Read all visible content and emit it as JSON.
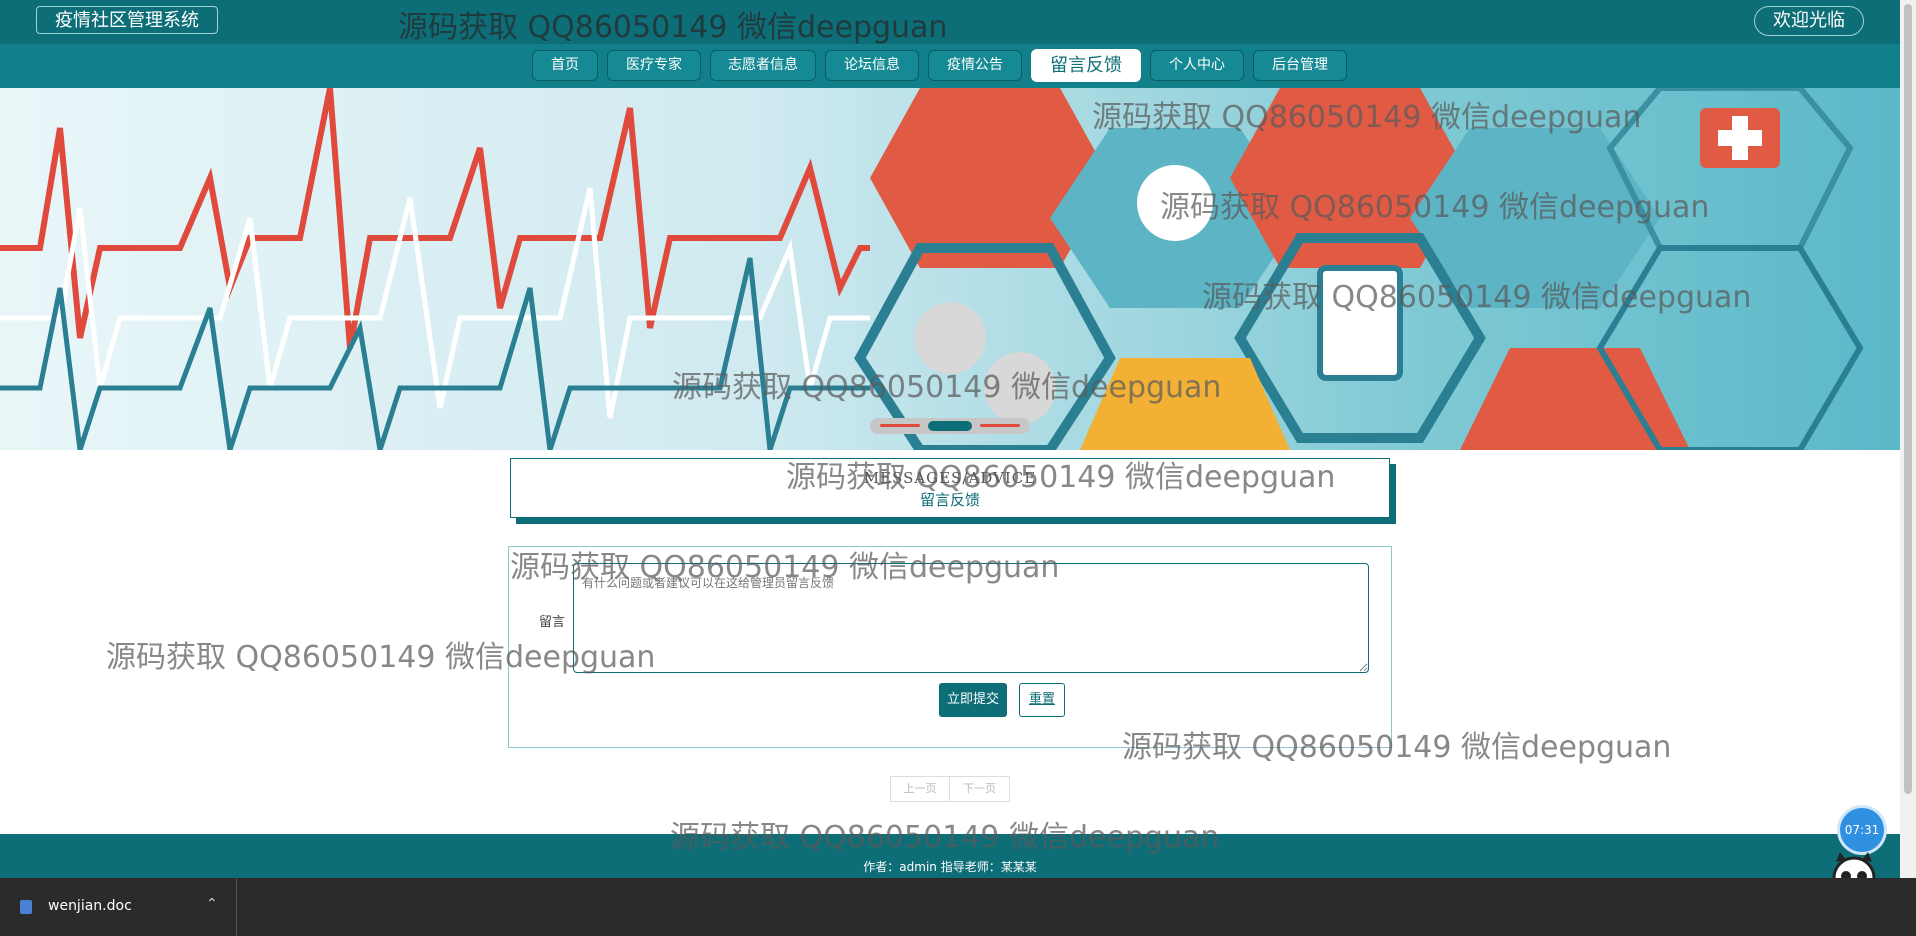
{
  "header": {
    "brand": "疫情社区管理系统",
    "welcome": "欢迎光临"
  },
  "nav": {
    "items": [
      {
        "label": "首页",
        "w": 66
      },
      {
        "label": "医疗专家",
        "w": 94
      },
      {
        "label": "志愿者信息",
        "w": 106
      },
      {
        "label": "论坛信息",
        "w": 94
      },
      {
        "label": "疫情公告",
        "w": 94
      },
      {
        "label": "留言反馈",
        "w": 110
      },
      {
        "label": "个人中心",
        "w": 94
      },
      {
        "label": "后台管理",
        "w": 94
      }
    ],
    "active_index": 5
  },
  "banner": {
    "slide_count": 3,
    "active_slide": 1
  },
  "section": {
    "title_en": "MESSAGES/ADVICE",
    "title_cn": "留言反馈"
  },
  "form": {
    "label": "留言",
    "placeholder": "有什么问题或者建议可以在这给管理员留言反馈",
    "submit_label": "立即提交",
    "reset_label": "重置"
  },
  "pagination": {
    "prev_label": "上一页",
    "next_label": "下一页"
  },
  "footer": {
    "text": "作者：admin 指导老师：某某某"
  },
  "clock": {
    "time": "07:31"
  },
  "taskbar": {
    "file_name": "wenjian.doc"
  },
  "watermark": {
    "text": "源码获取 QQ86050149 微信deepguan"
  },
  "colors": {
    "primary": "#0e6e78",
    "nav": "#12808a",
    "accent_red": "#e04a3c"
  }
}
